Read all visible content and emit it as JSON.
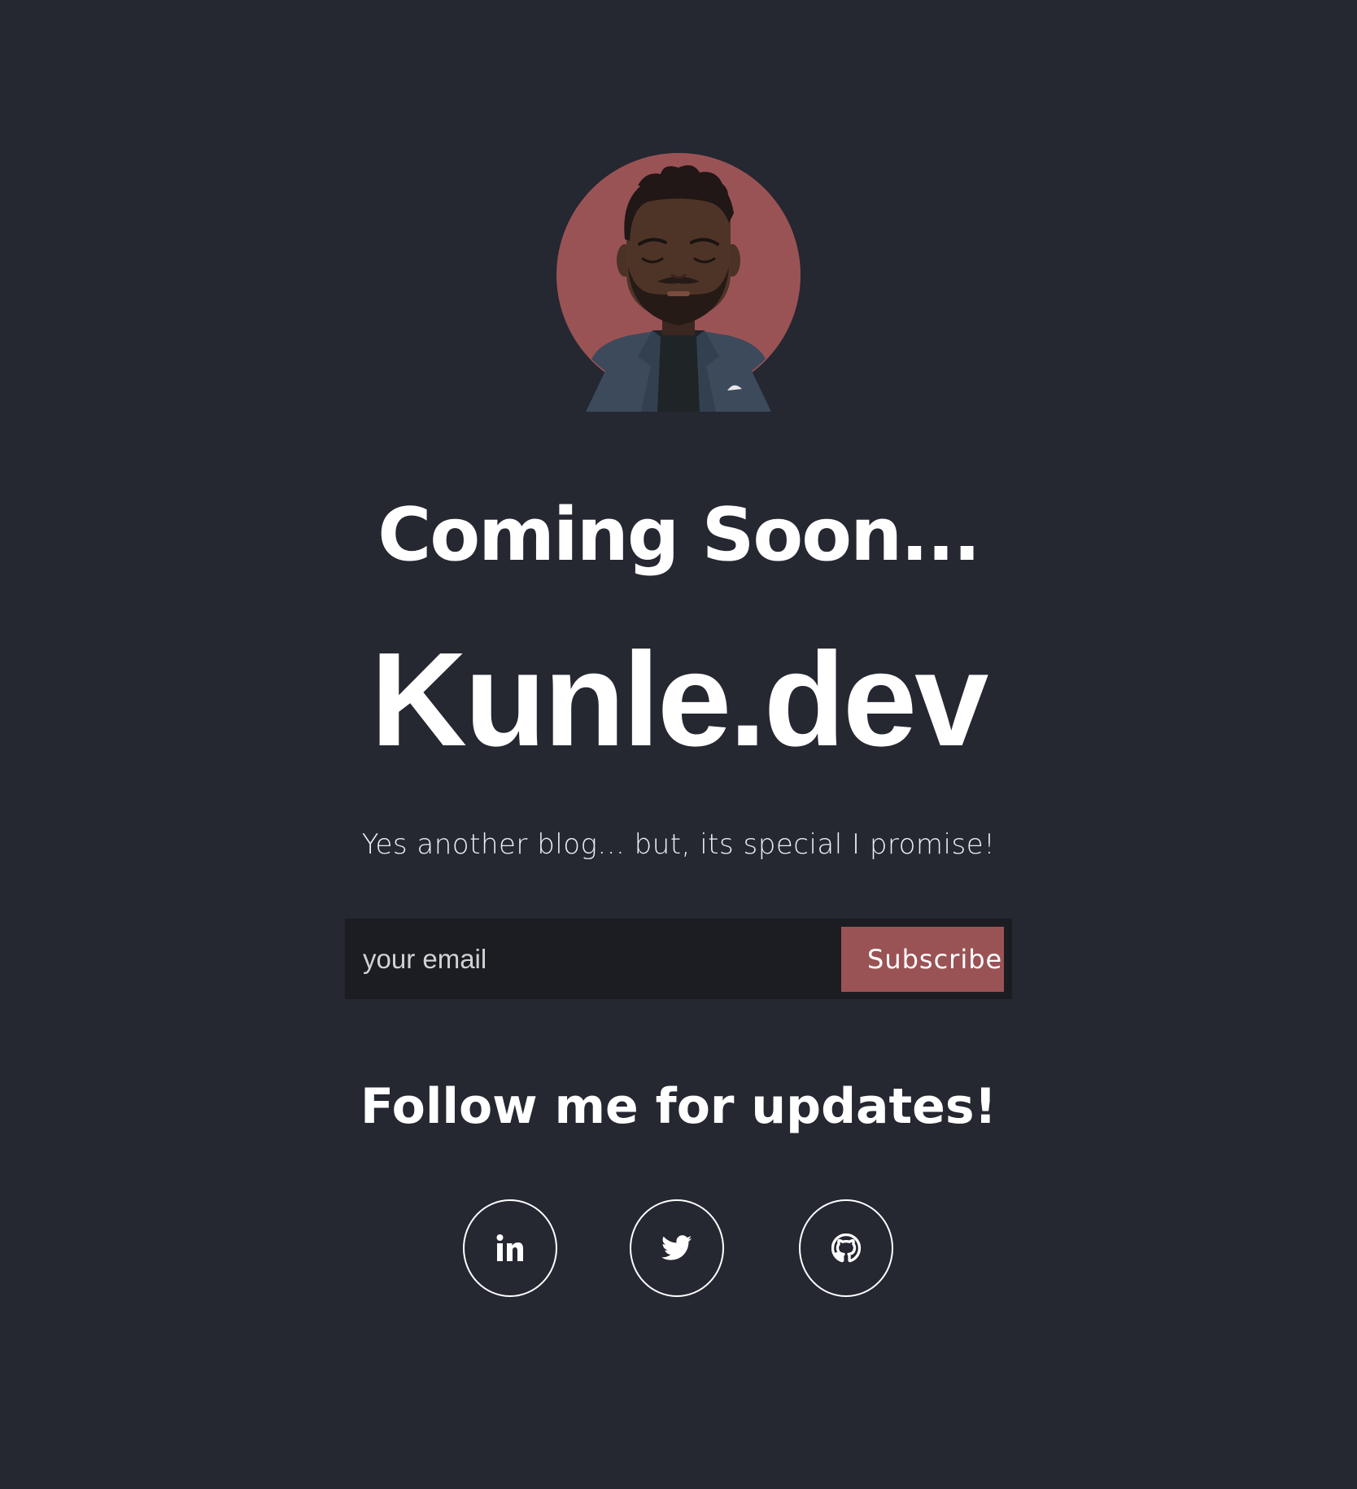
{
  "hero": {
    "title": "Coming Soon...",
    "brand": "Kunle.dev",
    "tagline": "Yes another blog... but, its special I promise!"
  },
  "subscribe": {
    "placeholder": "your email",
    "button_label": "Subscribe"
  },
  "follow": {
    "heading": "Follow me for updates!",
    "links": [
      {
        "icon": "linkedin-icon"
      },
      {
        "icon": "twitter-icon"
      },
      {
        "icon": "github-icon"
      }
    ]
  },
  "colors": {
    "background": "#252731",
    "accent": "#9a5355",
    "input_background": "#1c1d22",
    "text": "#ffffff"
  }
}
